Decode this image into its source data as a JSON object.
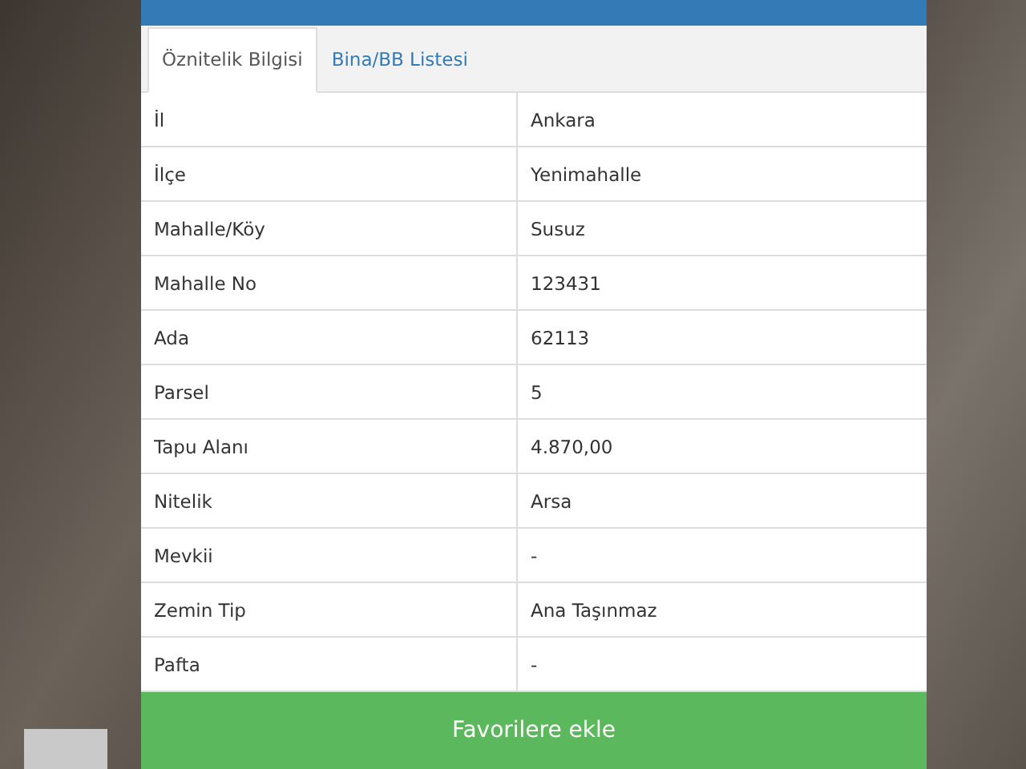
{
  "tabs": [
    {
      "label": "Öznitelik Bilgisi",
      "selected": true
    },
    {
      "label": "Bina/BB Listesi",
      "selected": false
    }
  ],
  "rows": [
    {
      "label": "İl",
      "value": "Ankara"
    },
    {
      "label": "İlçe",
      "value": "Yenimahalle"
    },
    {
      "label": "Mahalle/Köy",
      "value": "Susuz"
    },
    {
      "label": "Mahalle No",
      "value": "123431"
    },
    {
      "label": "Ada",
      "value": "62113"
    },
    {
      "label": "Parsel",
      "value": "5"
    },
    {
      "label": "Tapu Alanı",
      "value": "4.870,00"
    },
    {
      "label": "Nitelik",
      "value": "Arsa"
    },
    {
      "label": "Mevkii",
      "value": "-"
    },
    {
      "label": "Zemin Tip",
      "value": "Ana Taşınmaz"
    },
    {
      "label": "Pafta",
      "value": "-"
    }
  ],
  "button": "Favorilere ekle"
}
